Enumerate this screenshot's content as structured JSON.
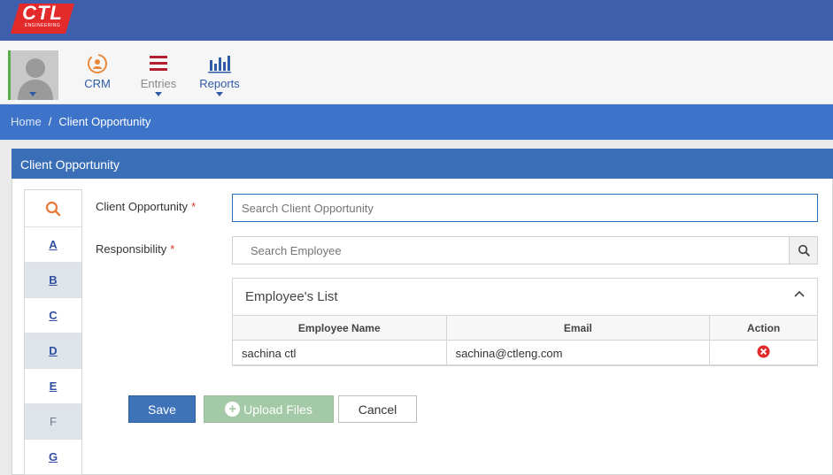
{
  "app": {
    "logo_text": "CTL",
    "logo_subtext": "ENGINEERING"
  },
  "nav": {
    "crm": "CRM",
    "entries": "Entries",
    "reports": "Reports"
  },
  "breadcrumb": {
    "home": "Home",
    "separator": "/",
    "current": "Client Opportunity"
  },
  "panel": {
    "title": "Client Opportunity"
  },
  "alpha_list": [
    "A",
    "B",
    "C",
    "D",
    "E",
    "F",
    "G"
  ],
  "form": {
    "client_opportunity_label": "Client Opportunity",
    "client_opportunity_placeholder": "Search Client Opportunity",
    "responsibility_label": "Responsibility",
    "employee_placeholder": "Search Employee",
    "required_mark": "*"
  },
  "employee_list": {
    "title": "Employee's List",
    "columns": [
      "Employee Name",
      "Email",
      "Action"
    ],
    "rows": [
      {
        "name": "sachina ctl",
        "email": "sachina@ctleng.com"
      }
    ]
  },
  "buttons": {
    "save": "Save",
    "upload": "Upload Files",
    "cancel": "Cancel"
  },
  "colors": {
    "topbar": "#3f5fad",
    "breadcrumb": "#3d74c9",
    "panel_header": "#3a6fb8",
    "logo_red": "#e32b2b",
    "accent_orange": "#e8883a",
    "entries_red": "#b32034"
  },
  "icons": {
    "alpha_search": "search-icon",
    "employee_search": "search-icon",
    "collapse": "chevron-up-icon",
    "remove": "remove-icon"
  }
}
